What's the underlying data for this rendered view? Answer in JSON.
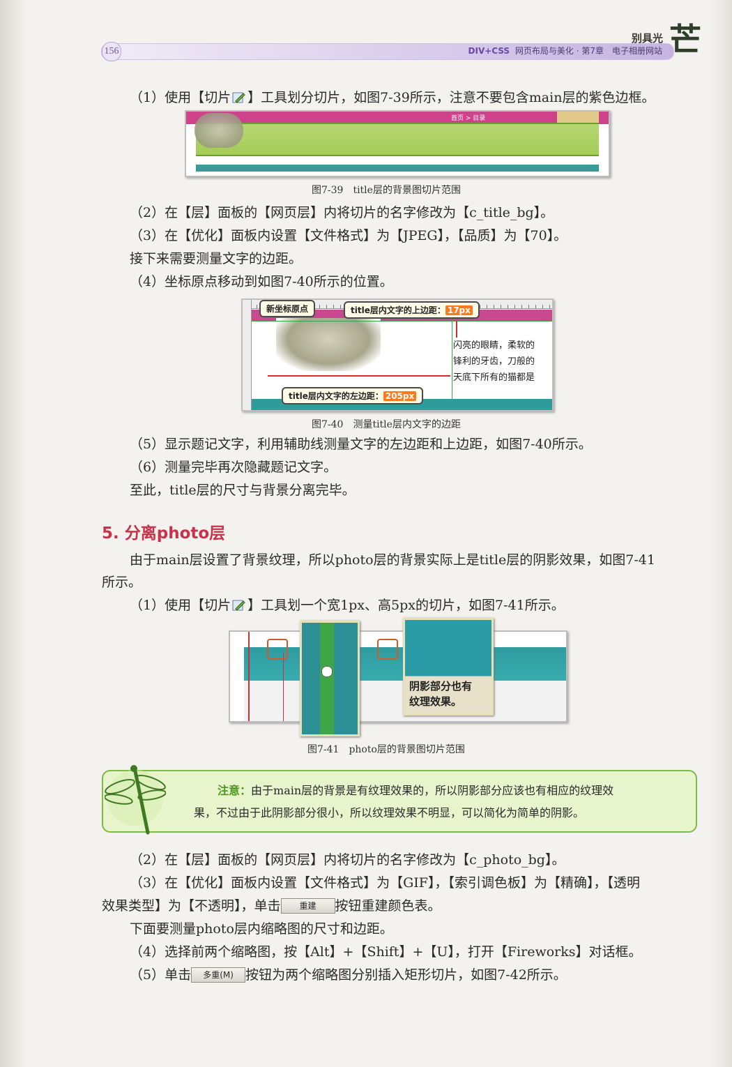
{
  "header": {
    "page_number": "156",
    "book": "DIV+CSS",
    "subtitle": "网页布局与美化 · 第7章　电子相册网站",
    "brand": "别具光",
    "brand_glyph": "芒"
  },
  "p1": "（1）使用【切片",
  "p1b": "】工具划分切片，如图7-39所示，注意不要包含main层的紫色边框。",
  "fig39": {
    "caption": "图7-39　title层的背景图切片范围",
    "breadcrumb": "首页 > 目录"
  },
  "p2": "（2）在【层】面板的【网页层】内将切片的名字修改为【c_title_bg】。",
  "p3": "（3）在【优化】面板内设置【文件格式】为【JPEG】，【品质】为【70】。",
  "p4": "接下来需要测量文字的边距。",
  "p5": "（4）坐标原点移动到如图7-40所示的位置。",
  "fig40": {
    "callout_origin": "新坐标原点",
    "callout_top_label": "title层内文字的上边距：",
    "callout_top_value": "17px",
    "callout_left_label": "title层内文字的左边距：",
    "callout_left_value": "205px",
    "cat_text_1": "闪亮的眼睛，柔软的",
    "cat_text_2": "锋利的牙齿，刀般的",
    "cat_text_3": "天底下所有的猫都是",
    "caption": "图7-40　测量title层内文字的边距"
  },
  "p6": "（5）显示题记文字，利用辅助线测量文字的左边距和上边距，如图7-40所示。",
  "p7": "（6）测量完毕再次隐藏题记文字。",
  "p8": "至此，title层的尺寸与背景分离完毕。",
  "heading": "5. 分离photo层",
  "p9a": "由于main层设置了背景纹理，所以photo层的背景实际上是title层的阴影效果，如图7-41",
  "p9b": "所示。",
  "p10": "（1）使用【切片",
  "p10b": "】工具划一个宽1px、高5px的切片，如图7-41所示。",
  "fig41": {
    "zoom_text_1": "阴影部分也有",
    "zoom_text_2": "纹理效果。",
    "caption": "图7-41　photo层的背景图切片范围"
  },
  "note": {
    "label": "注意：",
    "line1": "由于main层的背景是有纹理效果的，所以阴影部分应该也有相应的纹理效",
    "line2": "果，不过由于此阴影部分很小，所以纹理效果不明显，可以简化为简单的阴影。"
  },
  "p11": "（2）在【层】面板的【网页层】内将切片的名字修改为【c_photo_bg】。",
  "p12": "（3）在【优化】面板内设置【文件格式】为【GIF】，【索引调色板】为【精确】，【透明",
  "p13a": "效果类型】为【不透明】，单击",
  "rebuild_button": "重建",
  "p13b": "按钮重建颜色表。",
  "p14": "下面要测量photo层内缩略图的尺寸和边距。",
  "p15": "（4）选择前两个缩略图，按【Alt】+【Shift】+【U】，打开【Fireworks】对话框。",
  "p16a": "（5）单击",
  "multi_button": "多重(M)",
  "p16b": "按钮为两个缩略图分别插入矩形切片，如图7-42所示。"
}
